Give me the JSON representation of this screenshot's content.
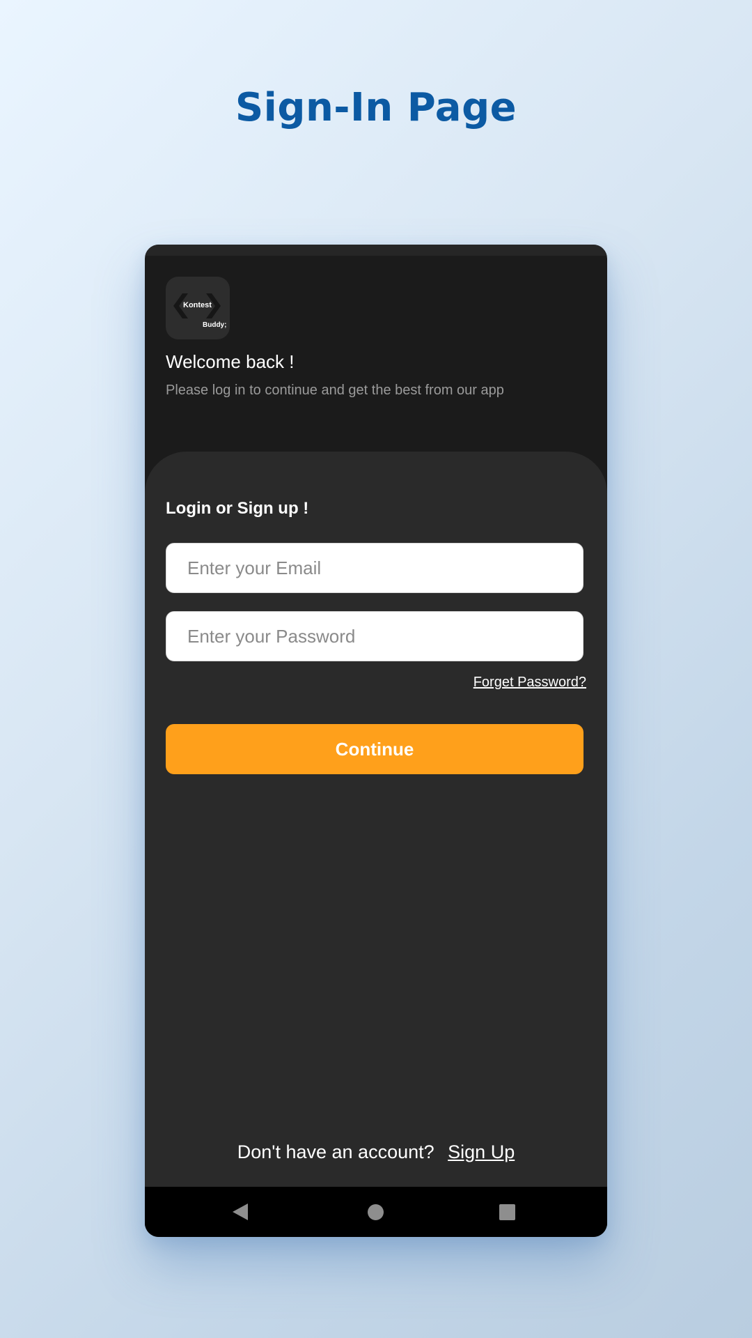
{
  "page": {
    "title": "Sign-In Page"
  },
  "app": {
    "logo": {
      "line1": "Kontest",
      "line2": "Buddy;"
    },
    "welcome": "Welcome back !",
    "subtitle": "Please log in to continue and get the best from our app"
  },
  "form": {
    "heading": "Login or Sign up !",
    "email_placeholder": "Enter your Email",
    "password_placeholder": "Enter your Password",
    "forgot_label": "Forget Password?",
    "continue_label": "Continue"
  },
  "footer": {
    "prompt": "Don't have an account?",
    "signup_label": "Sign Up"
  },
  "nav": {
    "back_icon": "back-triangle",
    "home_icon": "home-circle",
    "recents_icon": "recents-square"
  },
  "colors": {
    "accent": "#ffa01b",
    "title": "#0c5aa3",
    "surface": "#2a2a2a",
    "header": "#1b1b1b"
  }
}
